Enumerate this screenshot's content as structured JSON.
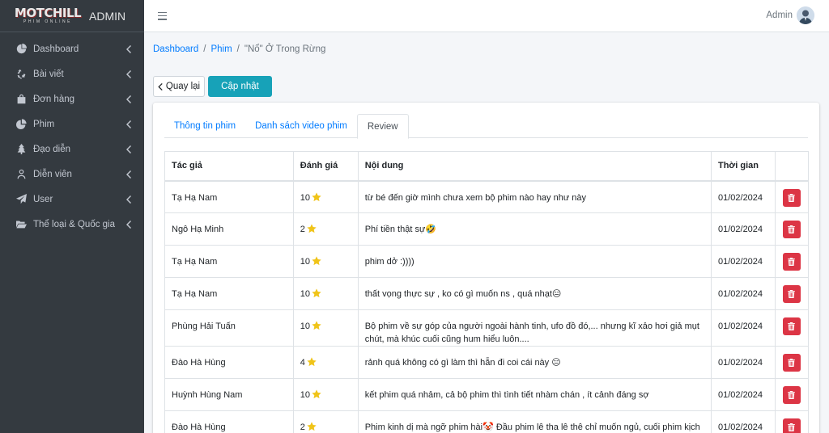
{
  "brand": {
    "logo_main": "MOTCHILL",
    "logo_sub": "PHIM ONLINE",
    "title": "ADMIN"
  },
  "sidebar": {
    "items": [
      {
        "label": "Dashboard",
        "icon": "dashboard-icon"
      },
      {
        "label": "Bài viết",
        "icon": "recycle-icon"
      },
      {
        "label": "Đơn hàng",
        "icon": "shopping-bag-icon"
      },
      {
        "label": "Phim",
        "icon": "pie-chart-icon"
      },
      {
        "label": "Đạo diễn",
        "icon": "tree-icon"
      },
      {
        "label": "Diễn viên",
        "icon": "user-icon"
      },
      {
        "label": "User",
        "icon": "paper-plane-icon"
      },
      {
        "label": "Thể loại & Quốc gia",
        "icon": "folder-open-icon"
      }
    ]
  },
  "header": {
    "admin_name": "Admin"
  },
  "breadcrumb": {
    "items": [
      "Dashboard",
      "Phim"
    ],
    "current": "\"Nổ\" Ở Trong Rừng"
  },
  "actions": {
    "back_label": "Quay lại",
    "update_label": "Cập nhật"
  },
  "tabs": [
    {
      "label": "Thông tin phim",
      "active": false
    },
    {
      "label": "Danh sách video phim",
      "active": false
    },
    {
      "label": "Review",
      "active": true
    }
  ],
  "table": {
    "headers": [
      "Tác giả",
      "Đánh giá",
      "Nội dung",
      "Thời gian",
      ""
    ],
    "rows": [
      {
        "author": "Tạ Hạ Nam",
        "rating": "10",
        "content": "từ bé đến giờ mình chưa xem bộ phim nào hay như này",
        "time": "01/02/2024"
      },
      {
        "author": "Ngô Hạ Minh",
        "rating": "2",
        "content": "Phí tiền thật sự🤣",
        "time": "01/02/2024"
      },
      {
        "author": "Tạ Hạ Nam",
        "rating": "10",
        "content": "phim dở :))))",
        "time": "01/02/2024"
      },
      {
        "author": "Tạ Hạ Nam",
        "rating": "10",
        "content": "thất vọng thực sự , ko có gì muốn ns , quá nhạt😑",
        "time": "01/02/2024"
      },
      {
        "author": "Phùng Hải Tuấn",
        "rating": "10",
        "content": "Bộ phim về sự góp của người ngoài hành tinh, ufo đồ đó,... nhưng kĩ xảo hơi giả mụt chút, mà khúc cuối cũng hum hiểu luôn....",
        "time": "01/02/2024"
      },
      {
        "author": "Đào Hà Hùng",
        "rating": "4",
        "content": "rảnh quá không có gì làm thì hẵn đi coi cái này 😑",
        "time": "01/02/2024"
      },
      {
        "author": "Huỳnh Hùng Nam",
        "rating": "10",
        "content": "kết phim quá nhảm, cả bộ phim thì tình tiết nhàm chán , ít cảnh đáng sợ",
        "time": "01/02/2024"
      },
      {
        "author": "Đào Hà Hùng",
        "rating": "2",
        "content": "Phim kinh dị mà ngỡ phim hài🤡 Đầu phim lê tha lê thê chỉ muốn ngủ, cuối phim kịch",
        "time": "01/02/2024"
      }
    ]
  },
  "colors": {
    "sidebar_bg": "#343a40",
    "accent": "#17a2b8",
    "link": "#007bff",
    "danger": "#dc3545",
    "star": "#f0c419"
  }
}
